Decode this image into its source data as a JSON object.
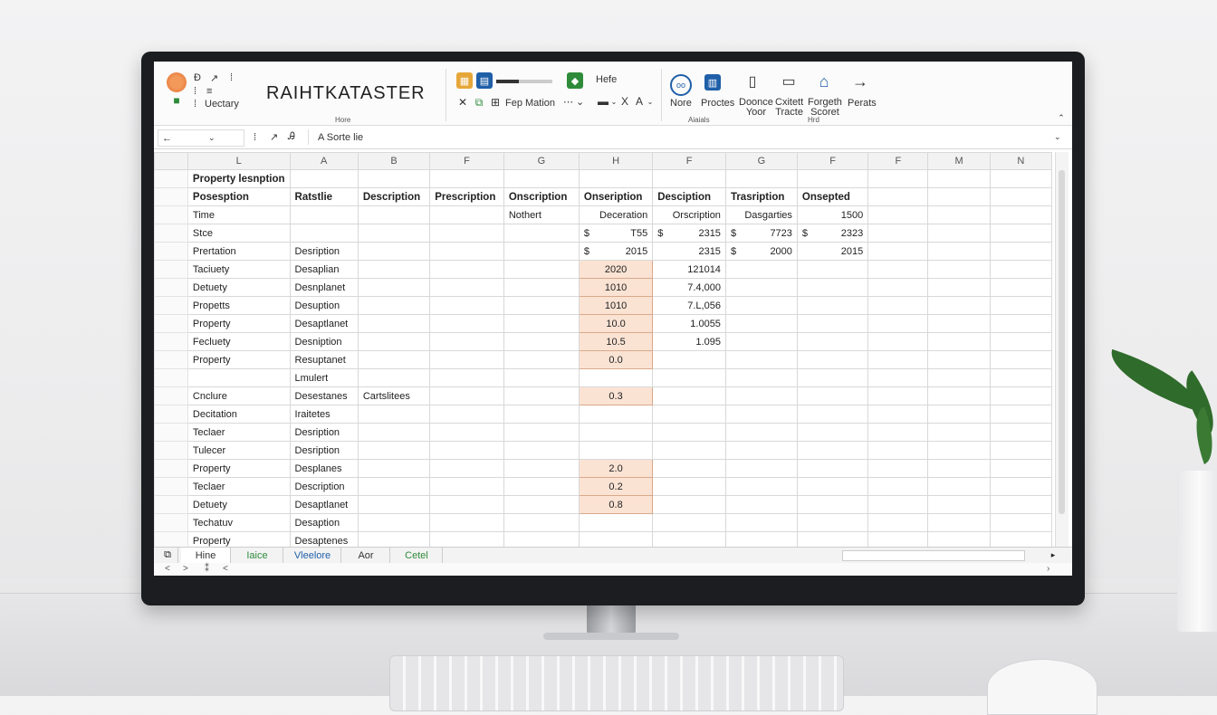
{
  "app_title": "RAIHTKATASTER",
  "ribbon": {
    "quick": [
      "Ð",
      "↗",
      "⁞",
      "⁞",
      "≡",
      "⁞",
      "Uectary"
    ],
    "clipboard": [
      "Hefe"
    ],
    "paste_label": "Fep Mation",
    "group_label_home": "Hore",
    "items": [
      {
        "label": "Nore"
      },
      {
        "label": "Proctes"
      },
      {
        "label": "Doonce\nYoor"
      },
      {
        "label": "Cxitett\nTracte"
      },
      {
        "label": "Forgeth\nScoret"
      },
      {
        "label": "Perats"
      }
    ],
    "group_label_a": "Aiaials",
    "group_label_b": "Hrd"
  },
  "formula_bar": {
    "name_box": "←",
    "value": "A Sorte lie",
    "fx_icons": [
      "⁞",
      "↗",
      "Ꭿ"
    ]
  },
  "columns": [
    "L",
    "A",
    "B",
    "F",
    "G",
    "H",
    "F",
    "G",
    "F",
    "F",
    "M",
    "N"
  ],
  "rows": [
    {
      "cells": [
        "Property lesnption",
        "",
        "",
        "",
        "",
        "",
        "",
        "",
        "",
        "",
        "",
        ""
      ],
      "bold": true
    },
    {
      "cells": [
        "Posesption",
        "Ratstlie",
        "Description",
        "Prescription",
        "Onscription",
        "Onseription",
        "Desciption",
        "Trasription",
        "Onsepted",
        "",
        "",
        ""
      ],
      "bold": true
    },
    {
      "cells": [
        "Time",
        "",
        "",
        "",
        "Nothert",
        "Deceration",
        "Orscription",
        "Dasgarties",
        "1500",
        "",
        "",
        ""
      ]
    },
    {
      "cells": [
        "Stce",
        "",
        "",
        "",
        "",
        "$|T55",
        "$|2315",
        "$|7723",
        "$|2323",
        "",
        "",
        ""
      ]
    },
    {
      "cells": [
        "Prertation",
        "Desription",
        "",
        "",
        "",
        "$|2015",
        "2315",
        "$|2000",
        "2015",
        "",
        "",
        ""
      ]
    },
    {
      "cells": [
        "Taciuety",
        "Desaplian",
        "",
        "",
        "",
        "2020",
        "121014",
        "",
        "",
        "",
        "",
        ""
      ]
    },
    {
      "cells": [
        "Detuety",
        "Desnplanet",
        "",
        "",
        "",
        "1010",
        "7.4,000",
        "",
        "",
        "",
        "",
        ""
      ]
    },
    {
      "cells": [
        "Propetts",
        "Desuption",
        "",
        "",
        "",
        "1010",
        "7.L,056",
        "",
        "",
        "",
        "",
        ""
      ]
    },
    {
      "cells": [
        "Property",
        "Desaptlanet",
        "",
        "",
        "",
        "10.0",
        "1.0055",
        "",
        "",
        "",
        "",
        ""
      ]
    },
    {
      "cells": [
        "Fecluety",
        "Desniption",
        "",
        "",
        "",
        "10.5",
        "1.095",
        "",
        "",
        "",
        "",
        ""
      ]
    },
    {
      "cells": [
        "Property",
        "Resuptanet",
        "",
        "",
        "",
        "0.0",
        "",
        "",
        "",
        "",
        "",
        ""
      ]
    },
    {
      "cells": [
        "",
        "Lmulert",
        "",
        "",
        "",
        "",
        "",
        "",
        "",
        "",
        "",
        ""
      ]
    },
    {
      "cells": [
        "Cnclure",
        "Desestanes",
        "Cartslitees",
        "",
        "",
        "0.3",
        "",
        "",
        "",
        "",
        "",
        ""
      ]
    },
    {
      "cells": [
        "Decitation",
        "Iraitetes",
        "",
        "",
        "",
        "",
        "",
        "",
        "",
        "",
        "",
        ""
      ]
    },
    {
      "cells": [
        "Teclaer",
        "Desription",
        "",
        "",
        "",
        "",
        "",
        "",
        "",
        "",
        "",
        ""
      ]
    },
    {
      "cells": [
        "Tulecer",
        "Desription",
        "",
        "",
        "",
        "",
        "",
        "",
        "",
        "",
        "",
        ""
      ]
    },
    {
      "cells": [
        "Property",
        "Desplanes",
        "",
        "",
        "",
        "2.0",
        "",
        "",
        "",
        "",
        "",
        ""
      ]
    },
    {
      "cells": [
        "Teclaer",
        "Description",
        "",
        "",
        "",
        "0.2",
        "",
        "",
        "",
        "",
        "",
        ""
      ]
    },
    {
      "cells": [
        "Detuety",
        "Desaptlanet",
        "",
        "",
        "",
        "0.8",
        "",
        "",
        "",
        "",
        "",
        ""
      ]
    },
    {
      "cells": [
        "Techatuv",
        "Desaption",
        "",
        "",
        "",
        "",
        "",
        "",
        "",
        "",
        "",
        ""
      ]
    },
    {
      "cells": [
        "Property",
        "Desaptenes",
        "",
        "",
        "",
        "",
        "",
        "",
        "",
        "",
        "",
        ""
      ]
    }
  ],
  "highlight_rows_col_H": [
    5,
    6,
    7,
    8,
    9,
    10,
    12,
    16,
    17,
    18
  ],
  "sheet_tabs": [
    {
      "label": "Hine",
      "color": "#333333",
      "active": true
    },
    {
      "label": "Iaice",
      "color": "#2e8b3a",
      "active": false
    },
    {
      "label": "Vleelore",
      "color": "#1f5fa8",
      "active": false
    },
    {
      "label": "Aor",
      "color": "#333333",
      "active": false
    },
    {
      "label": "Cetel",
      "color": "#2e8b3a",
      "active": false
    }
  ],
  "status_left": [
    "<",
    ">",
    "⁑",
    "<"
  ],
  "colors": {
    "highlight_fill": "#fbe3d4",
    "accent_blue": "#1f5fa8",
    "accent_green": "#2e8b3a"
  }
}
